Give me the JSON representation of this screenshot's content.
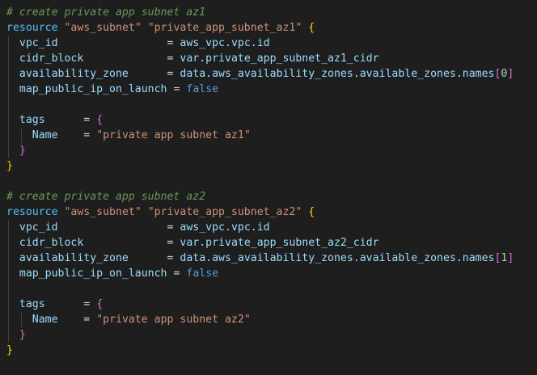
{
  "blocks": [
    {
      "comment": "# create private app subnet az1",
      "keyword": "resource",
      "type": "\"aws_subnet\"",
      "name": "\"private_app_subnet_az1\"",
      "attributes": [
        {
          "key": "vpc_id",
          "pad": "                 ",
          "value_parts": [
            "aws_vpc.vpc.id"
          ]
        },
        {
          "key": "cidr_block",
          "pad": "             ",
          "value_parts": [
            "var.private_app_subnet_az1_cidr"
          ]
        },
        {
          "key": "availability_zone",
          "pad": "      ",
          "value_parts": [
            "data.aws_availability_zones.available_zones.names",
            "[",
            "0",
            "]"
          ]
        },
        {
          "key": "map_public_ip_on_launch",
          "pad": "",
          "value_parts": [
            "false"
          ]
        }
      ],
      "tags_key": "tags",
      "tags_name_key": "Name",
      "tags_name_value": "\"private app subnet az1\""
    },
    {
      "comment": "# create private app subnet az2",
      "keyword": "resource",
      "type": "\"aws_subnet\"",
      "name": "\"private_app_subnet_az2\"",
      "attributes": [
        {
          "key": "vpc_id",
          "pad": "                 ",
          "value_parts": [
            "aws_vpc.vpc.id"
          ]
        },
        {
          "key": "cidr_block",
          "pad": "             ",
          "value_parts": [
            "var.private_app_subnet_az2_cidr"
          ]
        },
        {
          "key": "availability_zone",
          "pad": "      ",
          "value_parts": [
            "data.aws_availability_zones.available_zones.names",
            "[",
            "1",
            "]"
          ]
        },
        {
          "key": "map_public_ip_on_launch",
          "pad": "",
          "value_parts": [
            "false"
          ]
        }
      ],
      "tags_key": "tags",
      "tags_name_key": "Name",
      "tags_name_value": "\"private app subnet az2\""
    }
  ],
  "symbols": {
    "eq": "=",
    "open_brace": "{",
    "close_brace": "}"
  }
}
